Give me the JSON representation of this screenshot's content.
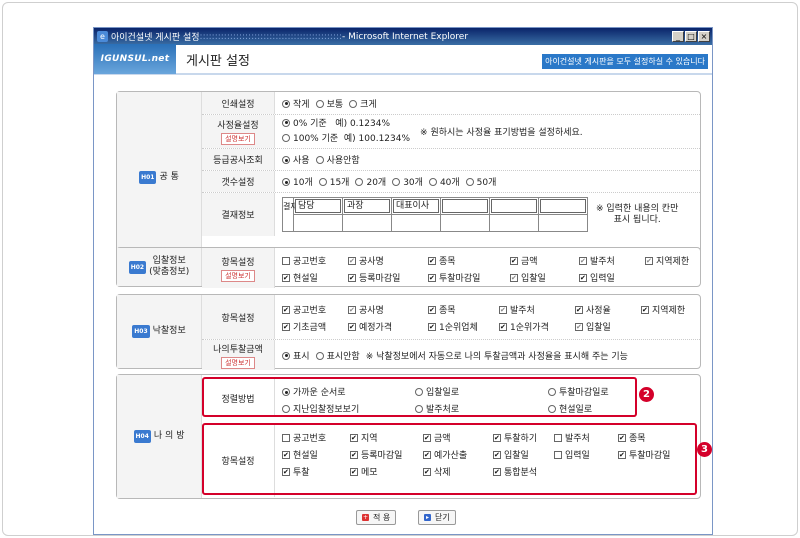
{
  "window": {
    "title": "아이건설넷 게시판 설정",
    "title_dots": ":::::::::::::::::::::::::::::::::::::::::::::::",
    "browser": " - Microsoft Internet Explorer",
    "min": "_",
    "max": "□",
    "close": "×"
  },
  "header": {
    "logo": "IGUNSUL.net",
    "title": "게시판 설정",
    "note": "아이건설넷 게시판을 모두 설정하실 수 있습니다"
  },
  "common": {
    "icon": "H01",
    "title": "공  통",
    "print": {
      "label": "인쇄설정",
      "options": [
        "작게",
        "보통",
        "크게"
      ],
      "selected": 0
    },
    "rate": {
      "label": "사정율설정",
      "help": "설명보기",
      "opt1": "0% 기준",
      "ex1": "예) 0.1234%",
      "opt2": "100% 기준",
      "ex2": "예) 100.1234%",
      "note": "※ 원하시는 사정율 표기방법을 설정하세요."
    },
    "grade": {
      "label": "등급공사조회",
      "options": [
        "사용",
        "사용안함"
      ]
    },
    "count": {
      "label": "갯수설정",
      "options": [
        "10개",
        "15개",
        "20개",
        "30개",
        "40개",
        "50개"
      ]
    },
    "approval": {
      "label": "결재정보",
      "gyeol": "결재",
      "slots": [
        "담당",
        "과장",
        "대표이사",
        "",
        "",
        ""
      ],
      "note1": "※ 입력한 내용의 칸만",
      "note2": "표시 됩니다."
    }
  },
  "bid": {
    "icon": "H02",
    "title": "입찰정보",
    "sub": "(맞춤정보)",
    "label": "항목설정",
    "help": "설명보기",
    "items": [
      [
        "공고번호",
        0
      ],
      [
        "공사명",
        2
      ],
      [
        "종목",
        1
      ],
      [
        "금액",
        1
      ],
      [
        "발주처",
        2
      ],
      [
        "지역제한",
        2
      ],
      [
        "현설일",
        1
      ],
      [
        "등록마감일",
        1
      ],
      [
        "투찰마감일",
        1
      ],
      [
        "입찰일",
        2
      ],
      [
        "입력일",
        1
      ]
    ]
  },
  "award": {
    "icon": "H03",
    "title": "낙찰정보",
    "label": "항목설정",
    "items": [
      [
        "공고번호",
        1
      ],
      [
        "공사명",
        2
      ],
      [
        "종목",
        1
      ],
      [
        "발주처",
        2
      ],
      [
        "사정율",
        1
      ],
      [
        "지역제한",
        1
      ],
      [
        "기초금액",
        1
      ],
      [
        "예정가격",
        1
      ],
      [
        "1순위업체",
        1
      ],
      [
        "1순위가격",
        1
      ],
      [
        "입찰일",
        2
      ]
    ],
    "mybid": {
      "label": "나의투찰금액",
      "help": "설명보기",
      "options": [
        "표시",
        "표시안함"
      ],
      "note": "※ 낙찰정보에서 자동으로 나의 투찰금액과 사정율을 표시해 주는 기능"
    }
  },
  "mine": {
    "icon": "H04",
    "title": "나 의 방",
    "sort": {
      "label": "정렬방법",
      "options": [
        "가까운 순서로",
        "입찰일로",
        "투찰마감일로",
        "지난입찰정보보기",
        "발주처로",
        "현설일로"
      ],
      "selected": 0,
      "badge": "2"
    },
    "items": {
      "label": "항목설정",
      "badge": "3",
      "list": [
        [
          "공고번호",
          0
        ],
        [
          "지역",
          1
        ],
        [
          "금액",
          1
        ],
        [
          "투찰하기",
          1
        ],
        [
          "발주처",
          0
        ],
        [
          "종목",
          1
        ],
        [
          "현설일",
          1
        ],
        [
          "등록마감일",
          1
        ],
        [
          "예가산출",
          1
        ],
        [
          "입찰일",
          1
        ],
        [
          "입력일",
          0
        ],
        [
          "투찰마감일",
          1
        ],
        [
          "투찰",
          1
        ],
        [
          "메모",
          1
        ],
        [
          "삭제",
          1
        ],
        [
          "통합분석",
          1
        ]
      ]
    }
  },
  "buttons": {
    "apply": "적 용",
    "close": "닫기"
  }
}
